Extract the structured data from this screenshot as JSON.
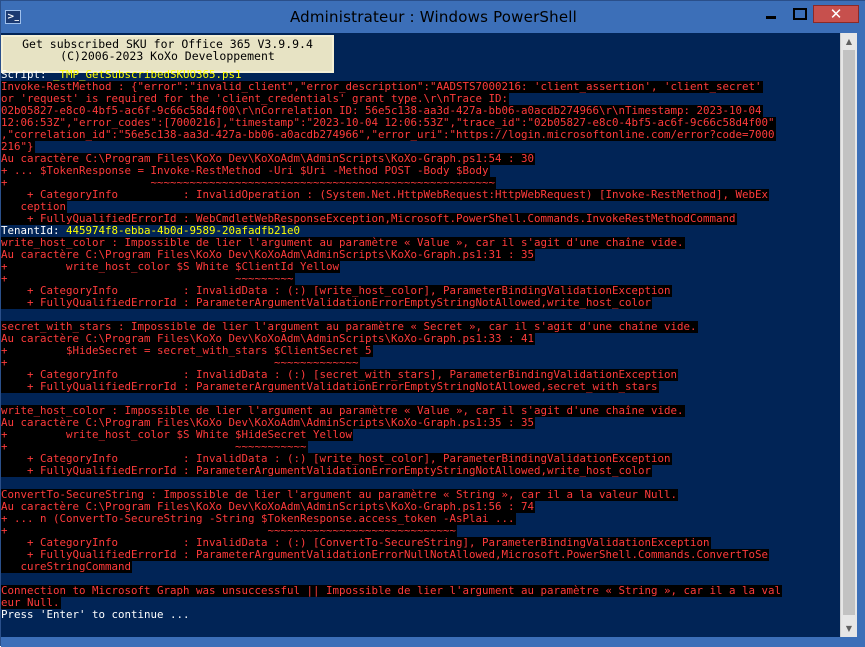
{
  "window": {
    "title": "Administrateur : Windows PowerShell",
    "icon_label": ">_",
    "close_glyph": "✕"
  },
  "banner": {
    "line1": "Get subscribed SKU for Office 365 V3.9.9.4",
    "line2": "(C)2006-2023 KoXo Developpement"
  },
  "console": {
    "script_label": "Script: ",
    "script_name": "_TMP_GetSubscribedSKUO365.ps1",
    "tenant_label": "TenantId: ",
    "tenant_id": "445974f8-ebba-4b0d-9589-20afadfb21e0",
    "error_lines_1": [
      "Invoke-RestMethod : {\"error\":\"invalid_client\",\"error_description\":\"AADSTS7000216: 'client_assertion', 'client_secret'",
      "or 'request' is required for the 'client_credentials' grant type.\\r\\nTrace ID:",
      "02b05827-e8c0-4bf5-ac6f-9c66c58d4f00\\r\\nCorrelation ID: 56e5c138-aa3d-427a-bb06-a0acdb274966\\r\\nTimestamp: 2023-10-04",
      "12:06:53Z\",\"error_codes\":[7000216],\"timestamp\":\"2023-10-04 12:06:53Z\",\"trace_id\":\"02b05827-e8c0-4bf5-ac6f-9c66c58d4f00\"",
      ",\"correlation_id\":\"56e5c138-aa3d-427a-bb06-a0acdb274966\",\"error_uri\":\"https://login.microsoftonline.com/error?code=7000",
      "216\"}",
      "Au caractère C:\\Program Files\\KoXo Dev\\KoXoAdm\\AdminScripts\\KoXo-Graph.ps1:54 : 30",
      "+ ... $TokenResponse = Invoke-RestMethod -Uri $Uri -Method POST -Body $Body",
      "+                      ~~~~~~~~~~~~~~~~~~~~~~~~~~~~~~~~~~~~~~~~~~~~~~~~~~~~~",
      "    + CategoryInfo          : InvalidOperation : (System.Net.HttpWebRequest:HttpWebRequest) [Invoke-RestMethod], WebEx",
      "   ception",
      "    + FullyQualifiedErrorId : WebCmdletWebResponseException,Microsoft.PowerShell.Commands.InvokeRestMethodCommand"
    ],
    "error_lines_2": [
      "write_host_color : Impossible de lier l'argument au paramètre « Value », car il s'agit d'une chaîne vide.",
      "Au caractère C:\\Program Files\\KoXo Dev\\KoXoAdm\\AdminScripts\\KoXo-Graph.ps1:31 : 35",
      "+         write_host_color $S White $ClientId Yellow",
      "+                                   ~~~~~~~~~",
      "    + CategoryInfo          : InvalidData : (:) [write_host_color], ParameterBindingValidationException",
      "    + FullyQualifiedErrorId : ParameterArgumentValidationErrorEmptyStringNotAllowed,write_host_color",
      "",
      "secret_with_stars : Impossible de lier l'argument au paramètre « Secret », car il s'agit d'une chaîne vide.",
      "Au caractère C:\\Program Files\\KoXo Dev\\KoXoAdm\\AdminScripts\\KoXo-Graph.ps1:33 : 41",
      "+         $HideSecret = secret_with_stars $ClientSecret 5",
      "+                                         ~~~~~~~~~~~~~",
      "    + CategoryInfo          : InvalidData : (:) [secret_with_stars], ParameterBindingValidationException",
      "    + FullyQualifiedErrorId : ParameterArgumentValidationErrorEmptyStringNotAllowed,secret_with_stars",
      "",
      "write_host_color : Impossible de lier l'argument au paramètre « Value », car il s'agit d'une chaîne vide.",
      "Au caractère C:\\Program Files\\KoXo Dev\\KoXoAdm\\AdminScripts\\KoXo-Graph.ps1:35 : 35",
      "+         write_host_color $S White $HideSecret Yellow",
      "+                                   ~~~~~~~~~~~",
      "    + CategoryInfo          : InvalidData : (:) [write_host_color], ParameterBindingValidationException",
      "    + FullyQualifiedErrorId : ParameterArgumentValidationErrorEmptyStringNotAllowed,write_host_color",
      "",
      "ConvertTo-SecureString : Impossible de lier l'argument au paramètre « String », car il a la valeur Null.",
      "Au caractère C:\\Program Files\\KoXo Dev\\KoXoAdm\\AdminScripts\\KoXo-Graph.ps1:56 : 74",
      "+ ... n (ConvertTo-SecureString -String $TokenResponse.access_token -AsPlai ...",
      "+                                        ~~~~~~~~~~~~~~~~~~~~~~~~~~~~~",
      "    + CategoryInfo          : InvalidData : (:) [ConvertTo-SecureString], ParameterBindingValidationException",
      "    + FullyQualifiedErrorId : ParameterArgumentValidationErrorNullNotAllowed,Microsoft.PowerShell.Commands.ConvertToSe",
      "   cureStringCommand",
      "",
      "Connection to Microsoft Graph was unsuccessful || Impossible de lier l'argument au paramètre « String », car il a la val",
      "eur Null."
    ],
    "prompt": "Press 'Enter' to continue ..."
  }
}
